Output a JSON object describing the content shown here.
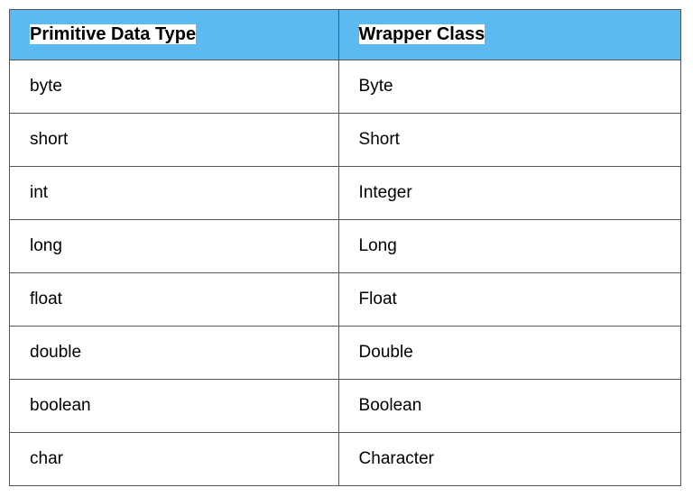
{
  "table": {
    "headers": {
      "primitive": "Primitive Data Type",
      "wrapper": "Wrapper Class"
    },
    "rows": [
      {
        "primitive": "byte",
        "wrapper": "Byte"
      },
      {
        "primitive": "short",
        "wrapper": "Short"
      },
      {
        "primitive": "int",
        "wrapper": "Integer"
      },
      {
        "primitive": "long",
        "wrapper": "Long"
      },
      {
        "primitive": "float",
        "wrapper": "Float"
      },
      {
        "primitive": "double",
        "wrapper": "Double"
      },
      {
        "primitive": "boolean",
        "wrapper": "Boolean"
      },
      {
        "primitive": "char",
        "wrapper": "Character"
      }
    ]
  }
}
